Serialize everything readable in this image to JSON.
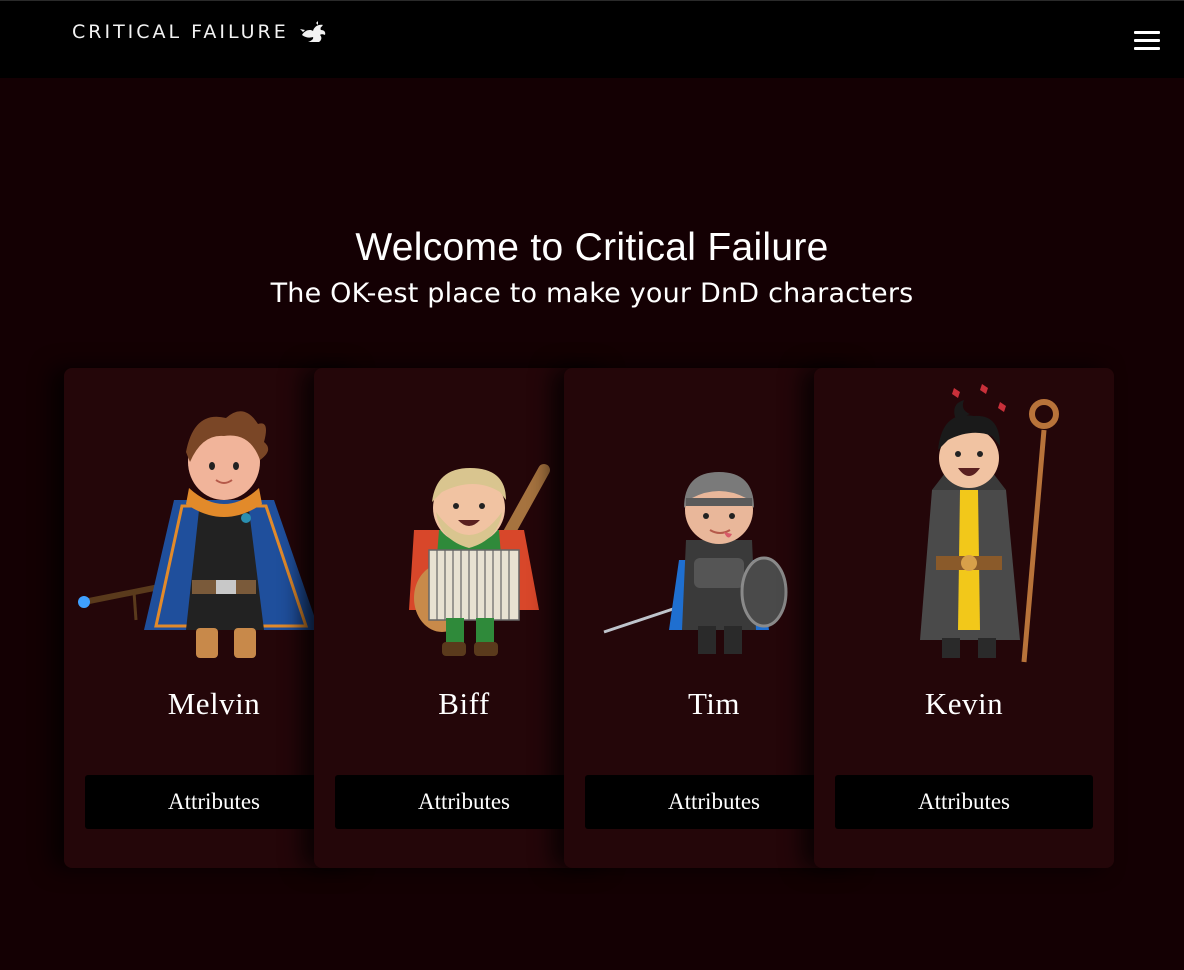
{
  "header": {
    "brand": "CRITICAL FAILURE",
    "logo_icon": "dragon-icon",
    "menu_icon": "hamburger-menu-icon"
  },
  "hero": {
    "title": "Welcome to Critical Failure",
    "subtitle": "The OK-est place to make your DnD characters"
  },
  "characters": [
    {
      "name": "Melvin",
      "button_label": "Attributes",
      "icon": "wizard-character-icon"
    },
    {
      "name": "Biff",
      "button_label": "Attributes",
      "icon": "bard-character-icon"
    },
    {
      "name": "Tim",
      "button_label": "Attributes",
      "icon": "fighter-character-icon"
    },
    {
      "name": "Kevin",
      "button_label": "Attributes",
      "icon": "sorcerer-character-icon"
    }
  ],
  "colors": {
    "background": "#140003",
    "card": "#240609",
    "header": "#000000",
    "button": "#000000",
    "text": "#ffffff"
  }
}
